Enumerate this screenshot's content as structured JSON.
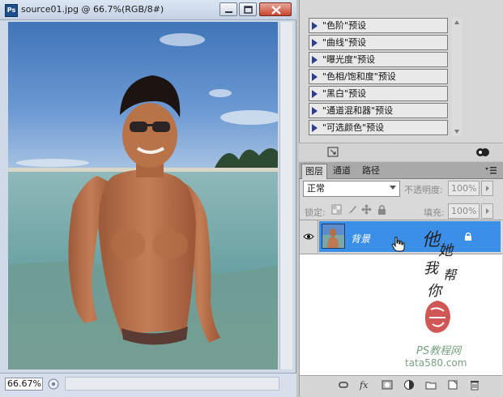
{
  "document": {
    "title": "source01.jpg @ 66.7%(RGB/8#)",
    "app_icon": "Ps",
    "zoom": "66.67%"
  },
  "adjustments": {
    "items": [
      {
        "label": "\"色阶\"预设"
      },
      {
        "label": "\"曲线\"预设"
      },
      {
        "label": "\"曝光度\"预设"
      },
      {
        "label": "\"色相/饱和度\"预设"
      },
      {
        "label": "\"黑白\"预设"
      },
      {
        "label": "\"通道混和器\"预设"
      },
      {
        "label": "\"可选颜色\"预设"
      }
    ]
  },
  "layers_panel": {
    "tabs": [
      "图层",
      "通道",
      "路径"
    ],
    "active_tab": "图层",
    "blend_mode": "正常",
    "opacity_label": "不透明度:",
    "opacity_value": "100%",
    "lock_label": "锁定:",
    "fill_label": "填充:",
    "fill_value": "100%",
    "layers": [
      {
        "name": "背景",
        "selected": true,
        "visible": true,
        "locked": true
      }
    ]
  },
  "watermark": {
    "handwriting": "他她我帮你",
    "text": "PS教程网",
    "url": "tata580.com"
  },
  "colors": {
    "selection": "#3b8fe6",
    "title_bar": "#c4d2e4"
  }
}
